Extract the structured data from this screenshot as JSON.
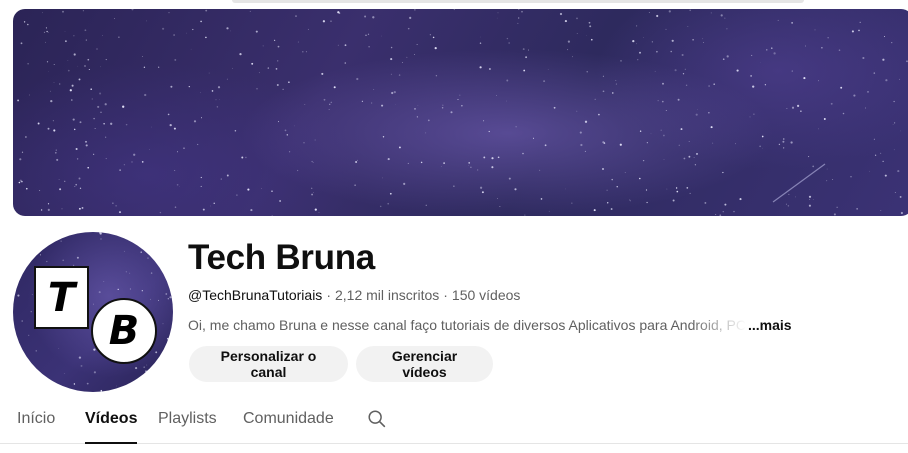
{
  "channel": {
    "name": "Tech Bruna",
    "handle": "@TechBrunaTutoriais",
    "separator": "·",
    "subscribers": "2,12 mil inscritos",
    "videos": "150 vídeos",
    "description": "Oi, me chamo Bruna e nesse canal faço tutoriais de diversos Aplicativos para Android, PC",
    "more_label": "...mais",
    "avatar_letters": {
      "top": "T",
      "bottom": "B"
    }
  },
  "actions": {
    "customize_label": "Personalizar o canal",
    "manage_label": "Gerenciar vídeos"
  },
  "tabs": [
    {
      "label": "Início",
      "active": false
    },
    {
      "label": "Vídeos",
      "active": true
    },
    {
      "label": "Playlists",
      "active": false
    },
    {
      "label": "Comunidade",
      "active": false
    }
  ],
  "icons": {
    "tab_search": "search-icon"
  },
  "colors": {
    "banner_base": "#2e2a5e",
    "text_primary": "#0f0f0f",
    "text_secondary": "#606060",
    "button_bg": "#f2f2f2"
  }
}
